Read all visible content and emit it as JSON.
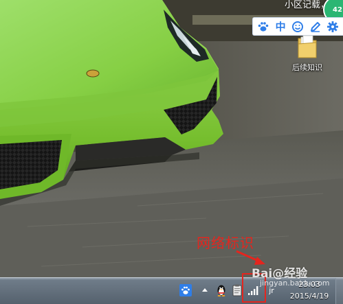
{
  "desktop": {
    "top_text": "小区记载，",
    "notification_count": "42",
    "icons": [
      {
        "label": "后续知识",
        "type": "folder"
      }
    ]
  },
  "ime_toolbar": {
    "buttons": [
      {
        "name": "paw",
        "label": ""
      },
      {
        "name": "lang",
        "label": "中"
      },
      {
        "name": "emoji",
        "label": ""
      },
      {
        "name": "pen",
        "label": ""
      },
      {
        "name": "settings",
        "label": ""
      }
    ],
    "accent": "#2f7ee8"
  },
  "annotation": {
    "text": "网络标识",
    "color": "#e5251e"
  },
  "taskbar": {
    "clock_time": "23:03",
    "clock_date": "2015/4/19",
    "tray_icons": [
      "baidu-paw-icon",
      "show-hidden-icon",
      "qq-icon",
      "clipboard-icon",
      "network-signal-icon",
      "ime-indicator-icon"
    ],
    "ime_indicator": "jr"
  },
  "watermark": {
    "text": "Bai@经验",
    "sub": "jingyan.baidu.com"
  }
}
